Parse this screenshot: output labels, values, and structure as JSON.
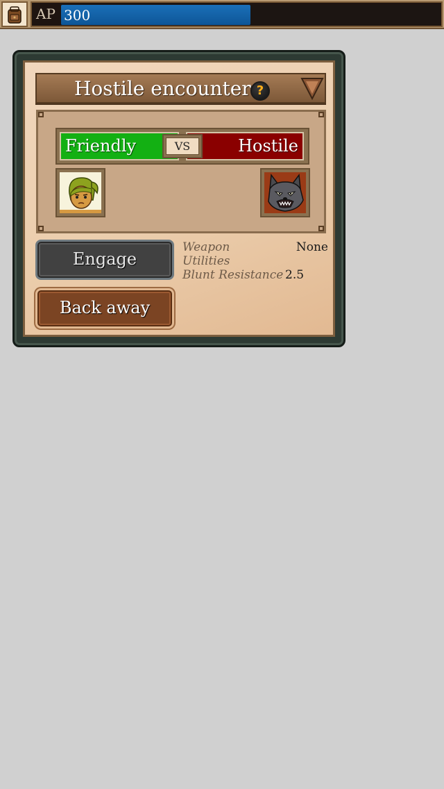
{
  "topbar": {
    "inventory_icon": "backpack-icon",
    "ap_label": "AP",
    "ap_value": "300",
    "ap_fill_fraction": 0.5,
    "ap_fill_color": "#1a6fb8"
  },
  "dialog": {
    "title": "Hostile encounter",
    "help_icon_glyph": "?",
    "help_icon": "help-icon",
    "collapse_icon": "triangle-down-icon",
    "friendly_label": "Friendly",
    "vs_label": "VS",
    "hostile_label": "Hostile",
    "friendly_color": "#13b013",
    "hostile_color": "#8a0000",
    "friendly_portrait": "player-avatar",
    "hostile_portrait": "wolf-avatar",
    "engage_label": "Engage",
    "back_away_label": "Back away",
    "stats": [
      {
        "label": "Weapon",
        "value": "None"
      },
      {
        "label": "Utilities",
        "value": ""
      },
      {
        "label": "Blunt Resistance",
        "value": "2.5"
      }
    ]
  }
}
